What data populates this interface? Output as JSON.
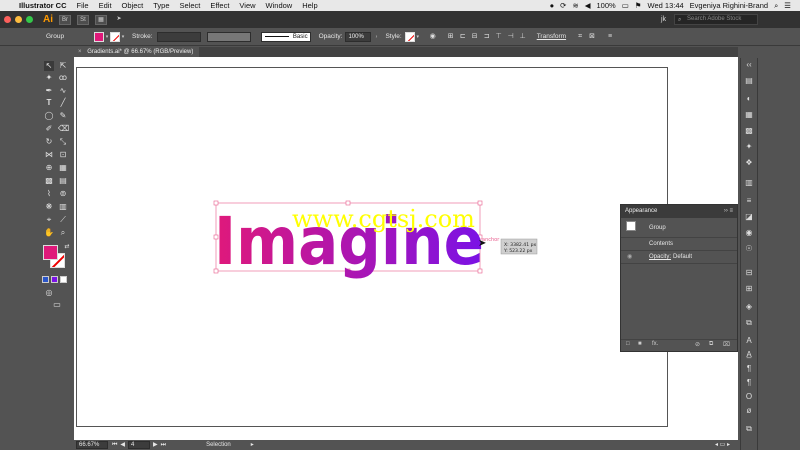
{
  "menubar": {
    "app_name": "Illustrator CC",
    "items": [
      "File",
      "Edit",
      "Object",
      "Type",
      "Select",
      "Effect",
      "View",
      "Window",
      "Help"
    ],
    "battery": "100%",
    "clock": "Wed 13:44",
    "user": "Evgeniya Righini-Brand"
  },
  "appbar": {
    "logo": "Ai",
    "btn_br": "Br",
    "btn_st": "St",
    "workspace_user": "jk",
    "search_placeholder": "Search Adobe Stock"
  },
  "control": {
    "selection_type": "Group",
    "stroke_label": "Stroke:",
    "brush_label": "Basic",
    "opacity_label": "Opacity:",
    "opacity_value": "100%",
    "style_label": "Style:",
    "transform_label": "Transform",
    "fill_color": "#e0197a"
  },
  "document": {
    "tab_title": "Gradients.ai* @ 66.67% (RGB/Preview)",
    "close_glyph": "×"
  },
  "artwork": {
    "word": "Imagine",
    "watermark": "www.cgtsj.com",
    "anchor_label": "anchor",
    "tooltip_x": "X: 3382.41 px",
    "tooltip_y": "Y: 523.22 px",
    "gradient_start": "#e0197a",
    "gradient_end": "#7a12e6",
    "watermark_color": "#ffff00"
  },
  "appearance": {
    "title": "Appearance",
    "item_group": "Group",
    "item_contents": "Contents",
    "opacity_label": "Opacity:",
    "opacity_value": "Default",
    "fx_label": "fx."
  },
  "status": {
    "zoom": "66.67%",
    "artboard_num": "4",
    "tool_name": "Selection"
  }
}
